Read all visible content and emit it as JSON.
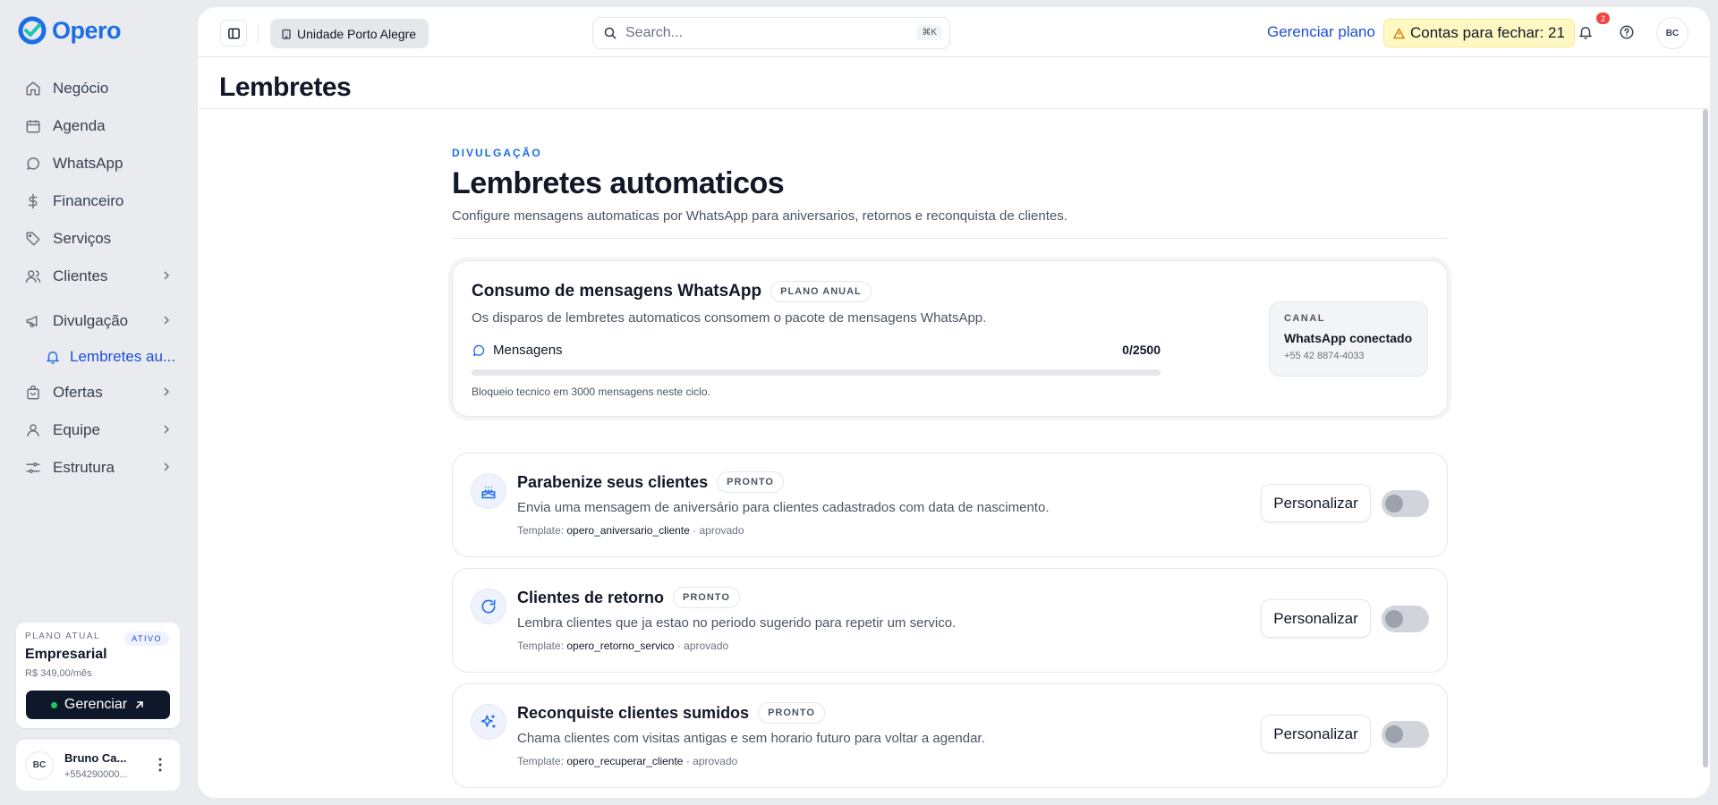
{
  "app": {
    "name": "Opero",
    "brand_color": "#1d6ee6"
  },
  "sidebar": {
    "items": [
      {
        "label": "Negócio",
        "icon": "home-icon"
      },
      {
        "label": "Agenda",
        "icon": "calendar-icon"
      },
      {
        "label": "WhatsApp",
        "icon": "chat-icon"
      },
      {
        "label": "Financeiro",
        "icon": "dollar-icon"
      },
      {
        "label": "Serviços",
        "icon": "tag-icon"
      },
      {
        "label": "Clientes",
        "icon": "users-icon"
      },
      {
        "label": "Divulgação",
        "icon": "megaphone-icon"
      },
      {
        "label": "Ofertas",
        "icon": "bag-icon"
      },
      {
        "label": "Equipe",
        "icon": "user-icon"
      },
      {
        "label": "Estrutura",
        "icon": "settings-icon"
      }
    ],
    "sub_item": {
      "label": "Lembretes au...",
      "icon": "bell-icon"
    },
    "plan": {
      "label": "PLANO ATUAL",
      "badge": "ATIVO",
      "name": "Empresarial",
      "price": "R$ 349,00/mês",
      "button": "Gerenciar"
    },
    "user": {
      "initials": "BC",
      "name": "Bruno Ca...",
      "phone": "+554290000..."
    }
  },
  "topbar": {
    "unit": "Unidade Porto Alegre",
    "search_placeholder": "Search...",
    "search_shortcut": "⌘K",
    "manage_plan": "Gerenciar plano",
    "accounts_alert": "Contas para fechar: 21",
    "notifications_count": "2",
    "avatar_initials": "BC"
  },
  "page": {
    "title": "Lembretes",
    "eyebrow": "DIVULGAÇÃO",
    "heading": "Lembretes automaticos",
    "subtitle": "Configure mensagens automaticas por WhatsApp para aniversarios, retornos e reconquista de clientes."
  },
  "usage": {
    "title": "Consumo de mensagens WhatsApp",
    "tag": "PLANO ANUAL",
    "description": "Os disparos de lembretes automaticos consomem o pacote de mensagens WhatsApp.",
    "messages_label": "Mensagens",
    "messages_count": "0/2500",
    "progress_fraction": 0,
    "note": "Bloqueio tecnico em 3000 mensagens neste ciclo.",
    "channel": {
      "label": "CANAL",
      "name": "WhatsApp conectado",
      "phone": "+55 42 8874-4033"
    }
  },
  "reminders": [
    {
      "title": "Parabenize seus clientes",
      "badge": "PRONTO",
      "description": "Envia uma mensagem de aniversário para clientes cadastrados com data de nascimento.",
      "template_label": "Template:",
      "template_name": "opero_aniversario_cliente",
      "template_status": "· aprovado",
      "button": "Personalizar",
      "enabled": false,
      "icon": "cake-icon"
    },
    {
      "title": "Clientes de retorno",
      "badge": "PRONTO",
      "description": "Lembra clientes que ja estao no periodo sugerido para repetir um servico.",
      "template_label": "Template:",
      "template_name": "opero_retorno_servico",
      "template_status": "· aprovado",
      "button": "Personalizar",
      "enabled": false,
      "icon": "refresh-icon"
    },
    {
      "title": "Reconquiste clientes sumidos",
      "badge": "PRONTO",
      "description": "Chama clientes com visitas antigas e sem horario futuro para voltar a agendar.",
      "template_label": "Template:",
      "template_name": "opero_recuperar_cliente",
      "template_status": "· aprovado",
      "button": "Personalizar",
      "enabled": false,
      "icon": "sparkles-icon"
    }
  ]
}
